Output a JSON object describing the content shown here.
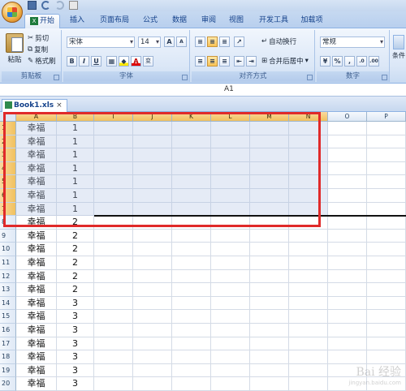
{
  "qat": {
    "save": "save-icon",
    "undo": "undo-icon",
    "redo": "redo-icon",
    "print": "print-icon"
  },
  "tabs": [
    "开始",
    "插入",
    "页面布局",
    "公式",
    "数据",
    "审阅",
    "视图",
    "开发工具",
    "加载项"
  ],
  "ribbon": {
    "clipboard": {
      "paste": "粘贴",
      "cut": "剪切",
      "copy": "复制",
      "format_painter": "格式刷",
      "label": "剪贴板"
    },
    "font": {
      "name": "宋体",
      "size": "14",
      "grow": "A",
      "shrink": "A",
      "bold": "B",
      "italic": "I",
      "underline": "U",
      "color_letter": "A",
      "phonetic": "变",
      "label": "字体"
    },
    "align": {
      "wrap": "自动换行",
      "merge": "合并后居中",
      "label": "对齐方式"
    },
    "number": {
      "format": "常规",
      "percent": "%",
      "comma": ",",
      "label": "数字"
    },
    "styles": {
      "conditional": "条件"
    }
  },
  "namebox": "A1",
  "book_tab": {
    "name": "Book1.xls",
    "close": "×"
  },
  "columns": [
    "A",
    "B",
    "I",
    "J",
    "K",
    "L",
    "M",
    "N",
    "O",
    "P"
  ],
  "selected_columns": [
    "A",
    "B",
    "I",
    "J",
    "K",
    "L",
    "M",
    "N"
  ],
  "rows": [
    {
      "n": "1",
      "a": "幸福",
      "b": "1"
    },
    {
      "n": "2",
      "a": "幸福",
      "b": "1"
    },
    {
      "n": "3",
      "a": "幸福",
      "b": "1"
    },
    {
      "n": "4",
      "a": "幸福",
      "b": "1"
    },
    {
      "n": "5",
      "a": "幸福",
      "b": "1"
    },
    {
      "n": "6",
      "a": "幸福",
      "b": "1"
    },
    {
      "n": "7",
      "a": "幸福",
      "b": "1"
    },
    {
      "n": "8",
      "a": "幸福",
      "b": "2"
    },
    {
      "n": "9",
      "a": "幸福",
      "b": "2"
    },
    {
      "n": "10",
      "a": "幸福",
      "b": "2"
    },
    {
      "n": "11",
      "a": "幸福",
      "b": "2"
    },
    {
      "n": "12",
      "a": "幸福",
      "b": "2"
    },
    {
      "n": "13",
      "a": "幸福",
      "b": "2"
    },
    {
      "n": "14",
      "a": "幸福",
      "b": "3"
    },
    {
      "n": "15",
      "a": "幸福",
      "b": "3"
    },
    {
      "n": "16",
      "a": "幸福",
      "b": "3"
    },
    {
      "n": "17",
      "a": "幸福",
      "b": "3"
    },
    {
      "n": "18",
      "a": "幸福",
      "b": "3"
    },
    {
      "n": "19",
      "a": "幸福",
      "b": "3"
    },
    {
      "n": "20",
      "a": "幸福",
      "b": "3"
    }
  ],
  "selected_rows": 7,
  "watermark": {
    "brand": "Bai 经验",
    "url": "jingyan.baidu.com"
  },
  "colors": {
    "highlight": "#e02a2a",
    "ribbon_text": "#15428b",
    "selection": "#f1c15e"
  }
}
